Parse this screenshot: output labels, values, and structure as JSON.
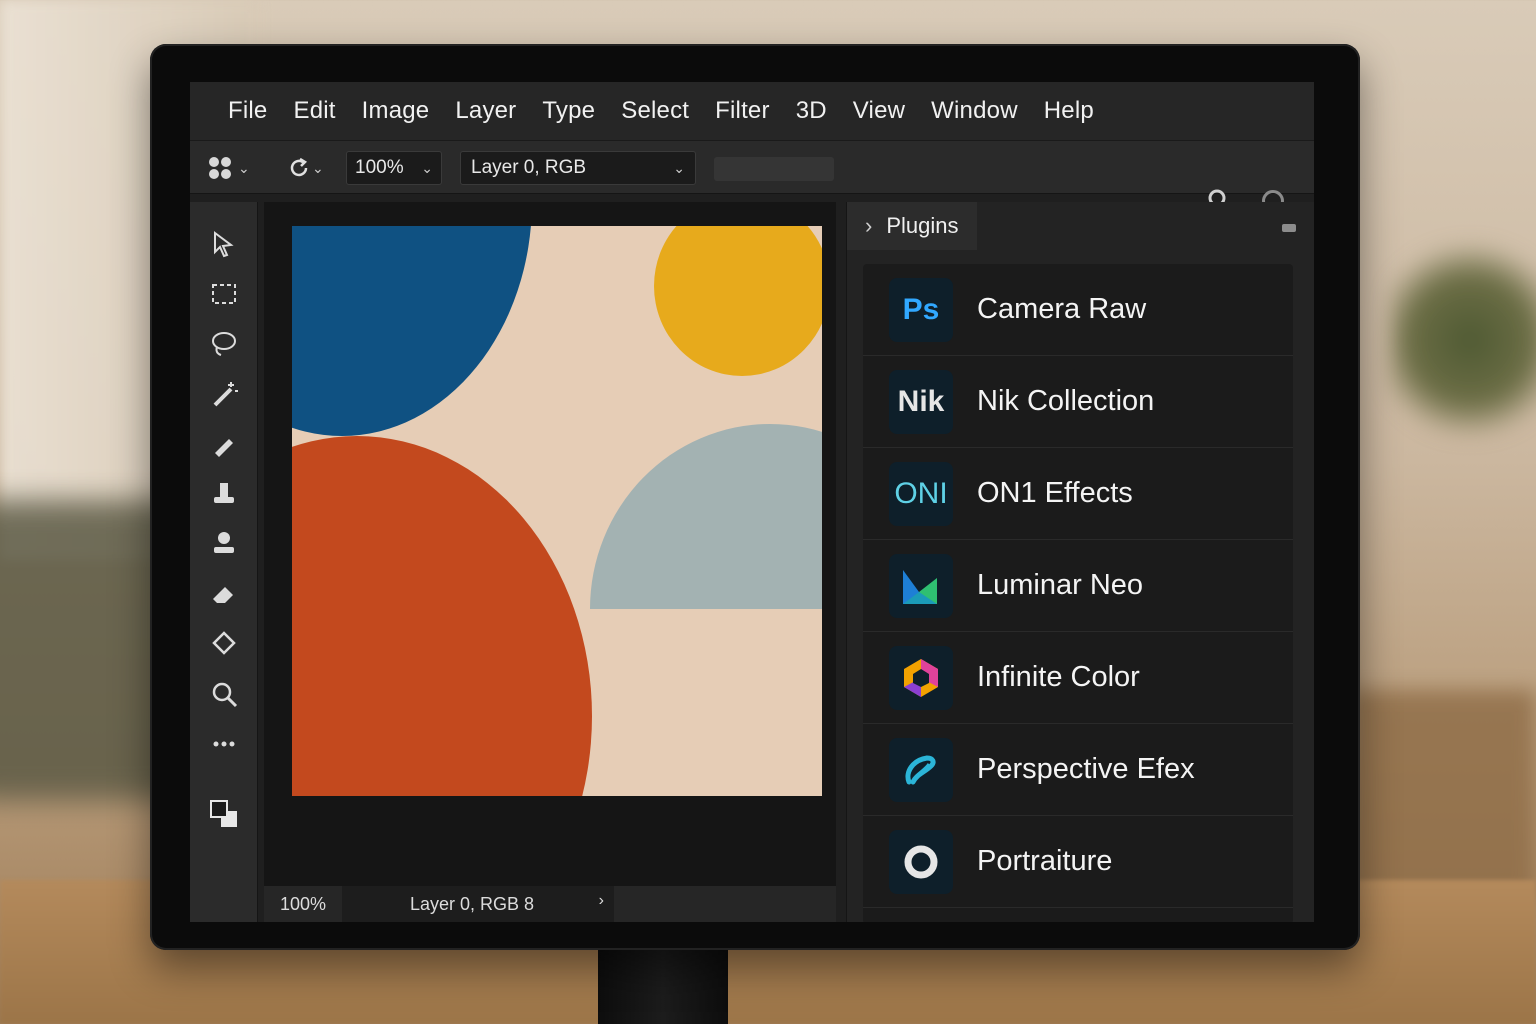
{
  "menu": [
    "File",
    "Edit",
    "Image",
    "Layer",
    "Type",
    "Select",
    "Filter",
    "3D",
    "View",
    "Window",
    "Help"
  ],
  "options": {
    "zoom_value": "100%",
    "layer_value": "Layer 0, RGB"
  },
  "status": {
    "zoom": "100%",
    "doc_info": "Layer 0, RGB 8"
  },
  "plugins": {
    "tab_label": "Plugins",
    "items": [
      {
        "icon_text": "Ps",
        "icon_color": "#31a8ff",
        "name": "Camera Raw"
      },
      {
        "icon_text": "Nik",
        "icon_color": "#e6e6e6",
        "name": "Nik Collection"
      },
      {
        "icon_text": "ONI",
        "icon_color": "#5fd1e6",
        "name": "ON1 Effects"
      },
      {
        "icon_text": "",
        "icon_color": "#2aa0e0",
        "name": "Luminar Neo"
      },
      {
        "icon_text": "",
        "icon_color": "#e0429a",
        "name": "Infinite Color"
      },
      {
        "icon_text": "",
        "icon_color": "#2bb5d8",
        "name": "Perspective Efex"
      },
      {
        "icon_text": "",
        "icon_color": "#e6e6e6",
        "name": "Portraiture"
      }
    ]
  },
  "canvas_colors": {
    "background": "#e6cdb6",
    "blue": "#0f5182",
    "yellow": "#e7aa1c",
    "orange": "#c3491e",
    "grey": "#a3b2b2"
  }
}
